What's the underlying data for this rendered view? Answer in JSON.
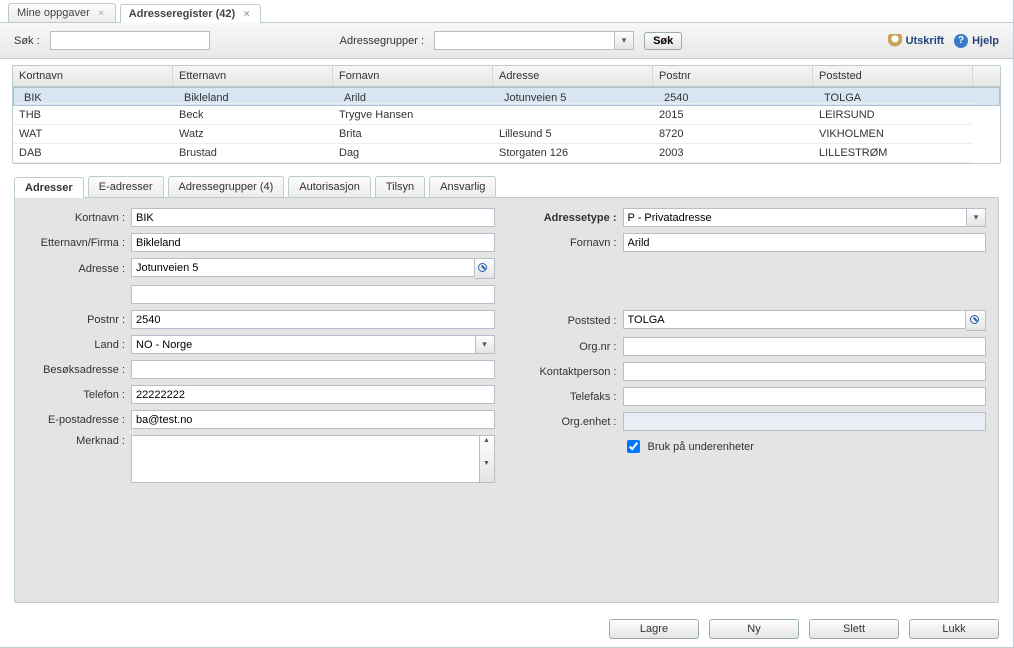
{
  "topTabs": [
    {
      "label": "Mine oppgaver"
    },
    {
      "label": "Adresseregister (42)",
      "active": true
    }
  ],
  "toolbar": {
    "sok_label": "Søk :",
    "sok_value": "",
    "adrgrp_label": "Adressegrupper :",
    "adrgrp_value": "",
    "sok_btn": "Søk",
    "utskrift": "Utskrift",
    "hjelp": "Hjelp"
  },
  "grid": {
    "cols": [
      "Kortnavn",
      "Etternavn",
      "Fornavn",
      "Adresse",
      "Postnr",
      "Poststed"
    ],
    "rows": [
      {
        "Kortnavn": "BIK",
        "Etternavn": "Bikleland",
        "Fornavn": "Arild",
        "Adresse": "Jotunveien 5",
        "Postnr": "2540",
        "Poststed": "TOLGA",
        "selected": true
      },
      {
        "Kortnavn": "THB",
        "Etternavn": "Beck",
        "Fornavn": "Trygve Hansen",
        "Adresse": "",
        "Postnr": "2015",
        "Poststed": "LEIRSUND"
      },
      {
        "Kortnavn": "WAT",
        "Etternavn": "Watz",
        "Fornavn": "Brita",
        "Adresse": "Lillesund 5",
        "Postnr": "8720",
        "Poststed": "VIKHOLMEN"
      },
      {
        "Kortnavn": "DAB",
        "Etternavn": "Brustad",
        "Fornavn": "Dag",
        "Adresse": "Storgaten 126",
        "Postnr": "2003",
        "Poststed": "LILLESTRØM"
      }
    ]
  },
  "detailTabs": [
    {
      "label": "Adresser",
      "active": true
    },
    {
      "label": "E-adresser"
    },
    {
      "label": "Adressegrupper (4)"
    },
    {
      "label": "Autorisasjon"
    },
    {
      "label": "Tilsyn"
    },
    {
      "label": "Ansvarlig"
    }
  ],
  "form": {
    "left": {
      "kortnavn": {
        "label": "Kortnavn :",
        "value": "BIK"
      },
      "etternavn": {
        "label": "Etternavn/Firma :",
        "value": "Bikleland"
      },
      "adresse": {
        "label": "Adresse :",
        "value": "Jotunveien 5",
        "value2": ""
      },
      "postnr": {
        "label": "Postnr :",
        "value": "2540"
      },
      "land": {
        "label": "Land :",
        "value": "NO - Norge"
      },
      "besoks": {
        "label": "Besøksadresse :",
        "value": ""
      },
      "telefon": {
        "label": "Telefon :",
        "value": "22222222"
      },
      "epost": {
        "label": "E-postadresse :",
        "value": "ba@test.no"
      },
      "merknad": {
        "label": "Merknad :",
        "value": ""
      }
    },
    "right": {
      "adressetype": {
        "label": "Adressetype :",
        "value": "P - Privatadresse"
      },
      "fornavn": {
        "label": "Fornavn :",
        "value": "Arild"
      },
      "poststed": {
        "label": "Poststed :",
        "value": "TOLGA"
      },
      "orgnr": {
        "label": "Org.nr :",
        "value": ""
      },
      "kontaktperson": {
        "label": "Kontaktperson :",
        "value": ""
      },
      "telefaks": {
        "label": "Telefaks :",
        "value": ""
      },
      "orgenhet": {
        "label": "Org.enhet :",
        "value": ""
      },
      "bruk": {
        "label": "Bruk på underenheter",
        "checked": true
      }
    }
  },
  "footer": {
    "lagre": "Lagre",
    "ny": "Ny",
    "slett": "Slett",
    "lukk": "Lukk"
  }
}
